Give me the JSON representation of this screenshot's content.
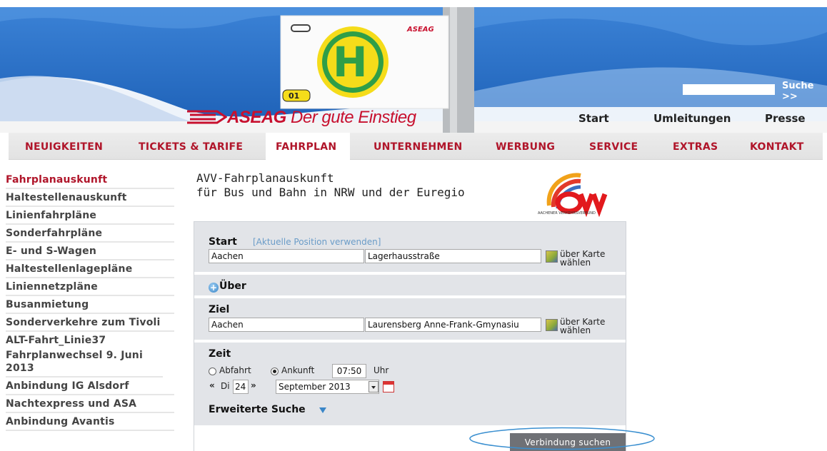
{
  "header": {
    "logo_company": "ASEAG",
    "logo_slogan": " Der gute Einstieg",
    "search_link": "Suche >>",
    "stop_sign": {
      "letter": "H",
      "brand_small": "ASEAG",
      "number": "01"
    },
    "top_links": [
      "Start",
      "Umleitungen",
      "Presse"
    ]
  },
  "nav": {
    "items": [
      "NEUIGKEITEN",
      "TICKETS & TARIFE",
      "FAHRPLAN",
      "UNTERNEHMEN",
      "WERBUNG",
      "SERVICE",
      "EXTRAS",
      "KONTAKT"
    ],
    "active": "FAHRPLAN"
  },
  "sidebar": {
    "items": [
      "Fahrplanauskunft",
      "Haltestellenauskunft",
      "Linienfahrpläne",
      "Sonderfahrpläne",
      "E- und S-Wagen",
      "Haltestellenlagepläne",
      "Liniennetzpläne",
      "Busanmietung",
      "Sonderverkehre zum Tivoli",
      "ALT-Fahrt_Linie37",
      "Fahrplanwechsel 9. Juni 2013",
      "Anbindung IG Alsdorf",
      "Nachtexpress und ASA",
      "Anbindung Avantis"
    ]
  },
  "content": {
    "title_line1": "AVV-Fahrplanauskunft",
    "title_line2": "für Bus und Bahn in NRW und der Euregio",
    "avv_logo_caption": "AACHENER VERKEHRSVERBUND",
    "avv_logo_text": "avv"
  },
  "form": {
    "start": {
      "label": "Start",
      "position_link": "[Aktuelle Position verwenden]",
      "city": "Aachen",
      "stop": "Lagerhausstraße",
      "map_line1": "über Karte",
      "map_line2": "wählen"
    },
    "via": {
      "label": "Über"
    },
    "ziel": {
      "label": "Ziel",
      "city": "Aachen",
      "stop": "Laurensberg Anne-Frank-Gmynasiu",
      "map_line1": "über Karte",
      "map_line2": "wählen"
    },
    "zeit": {
      "label": "Zeit",
      "abfahrt": "Abfahrt",
      "ankunft": "Ankunft",
      "selected": "Ankunft",
      "time": "07:50",
      "uhr": "Uhr",
      "prev": "«",
      "weekday": "Di",
      "day": "24",
      "next": "»",
      "month": "September 2013"
    },
    "advanced": "Erweiterte Suche",
    "submit": "Verbindung suchen"
  },
  "colors": {
    "brand_red": "#b0152a",
    "header_blue": "#2a6fc4",
    "panel_grey": "#e2e4e8",
    "button_grey": "#6f7176"
  }
}
